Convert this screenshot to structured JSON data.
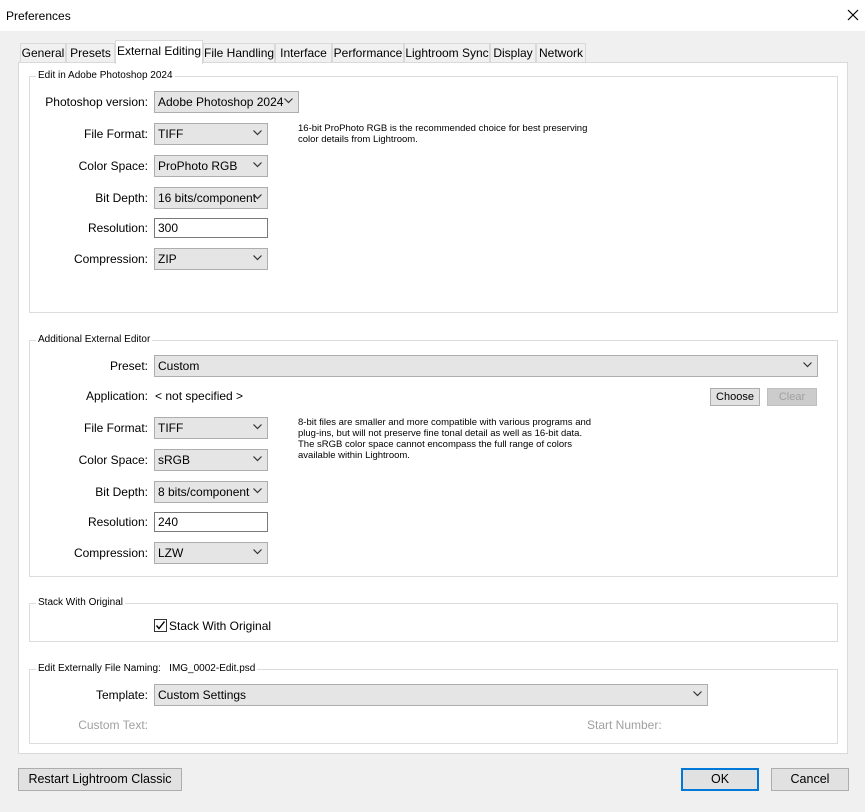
{
  "window": {
    "title": "Preferences"
  },
  "tabs": [
    {
      "label": "General",
      "active": false
    },
    {
      "label": "Presets",
      "active": false
    },
    {
      "label": "External Editing",
      "active": true
    },
    {
      "label": "File Handling",
      "active": false
    },
    {
      "label": "Interface",
      "active": false
    },
    {
      "label": "Performance",
      "active": false
    },
    {
      "label": "Lightroom Sync",
      "active": false
    },
    {
      "label": "Display",
      "active": false
    },
    {
      "label": "Network",
      "active": false
    }
  ],
  "photoshop": {
    "title": "Edit in Adobe Photoshop 2024",
    "version_label": "Photoshop version:",
    "version_value": "Adobe Photoshop 2024",
    "file_format_label": "File Format:",
    "file_format_value": "TIFF",
    "color_space_label": "Color Space:",
    "color_space_value": "ProPhoto RGB",
    "bit_depth_label": "Bit Depth:",
    "bit_depth_value": "16 bits/component",
    "resolution_label": "Resolution:",
    "resolution_value": "300",
    "compression_label": "Compression:",
    "compression_value": "ZIP",
    "note_line1": "16-bit ProPhoto RGB is the recommended choice for best preserving",
    "note_line2": "color details from Lightroom."
  },
  "additional": {
    "title": "Additional External Editor",
    "preset_label": "Preset:",
    "preset_value": "Custom",
    "application_label": "Application:",
    "application_value": "< not specified >",
    "choose_button": "Choose",
    "clear_button": "Clear",
    "file_format_label": "File Format:",
    "file_format_value": "TIFF",
    "color_space_label": "Color Space:",
    "color_space_value": "sRGB",
    "bit_depth_label": "Bit Depth:",
    "bit_depth_value": "8 bits/component",
    "resolution_label": "Resolution:",
    "resolution_value": "240",
    "compression_label": "Compression:",
    "compression_value": "LZW",
    "note_line1": "8-bit files are smaller and more compatible with various programs and",
    "note_line2": "plug-ins, but will not preserve fine tonal detail as well as 16-bit data.",
    "note_line3": "The sRGB color space cannot encompass the full range of colors",
    "note_line4": "available within Lightroom."
  },
  "stack": {
    "title": "Stack With Original",
    "checkbox_label": "Stack With Original",
    "checked": true
  },
  "naming": {
    "title": "Edit Externally File Naming:",
    "example": "IMG_0002-Edit.psd",
    "template_label": "Template:",
    "template_value": "Custom Settings",
    "custom_text_label": "Custom Text:",
    "start_number_label": "Start Number:"
  },
  "footer": {
    "restart_button": "Restart Lightroom Classic",
    "ok_button": "OK",
    "cancel_button": "Cancel"
  },
  "colors": {
    "accent": "#0078d7",
    "background": "#f0f0f0",
    "panel": "#ffffff"
  }
}
